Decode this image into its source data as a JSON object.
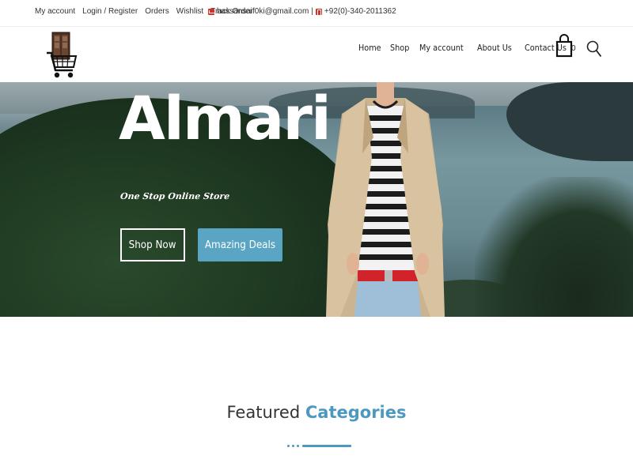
{
  "topbar": {
    "links": [
      "My account",
      "Login / Register",
      "Orders",
      "Wishlist",
      "Track Order"
    ],
    "email": "hassansaif0ki@gmail.com",
    "separator": "|",
    "phone": "+92(0)-340-2011362"
  },
  "header": {
    "nav": [
      "Home",
      "Shop",
      "My account",
      "About Us",
      "Contact Us"
    ],
    "cart_count": "0"
  },
  "hero": {
    "title": "Almari",
    "subtitle": "One Stop Online Store",
    "primary_button": "Shop Now",
    "secondary_button": "Amazing Deals"
  },
  "featured": {
    "title_part1": "Featured",
    "title_part2": "Categories"
  },
  "colors": {
    "accent": "#5aa4c4",
    "heading_accent": "#4c98bf",
    "email_icon": "#d93025"
  },
  "icons": [
    "logo-cart-icon",
    "mail-icon",
    "phone-icon",
    "shopping-bag-icon",
    "search-icon"
  ]
}
